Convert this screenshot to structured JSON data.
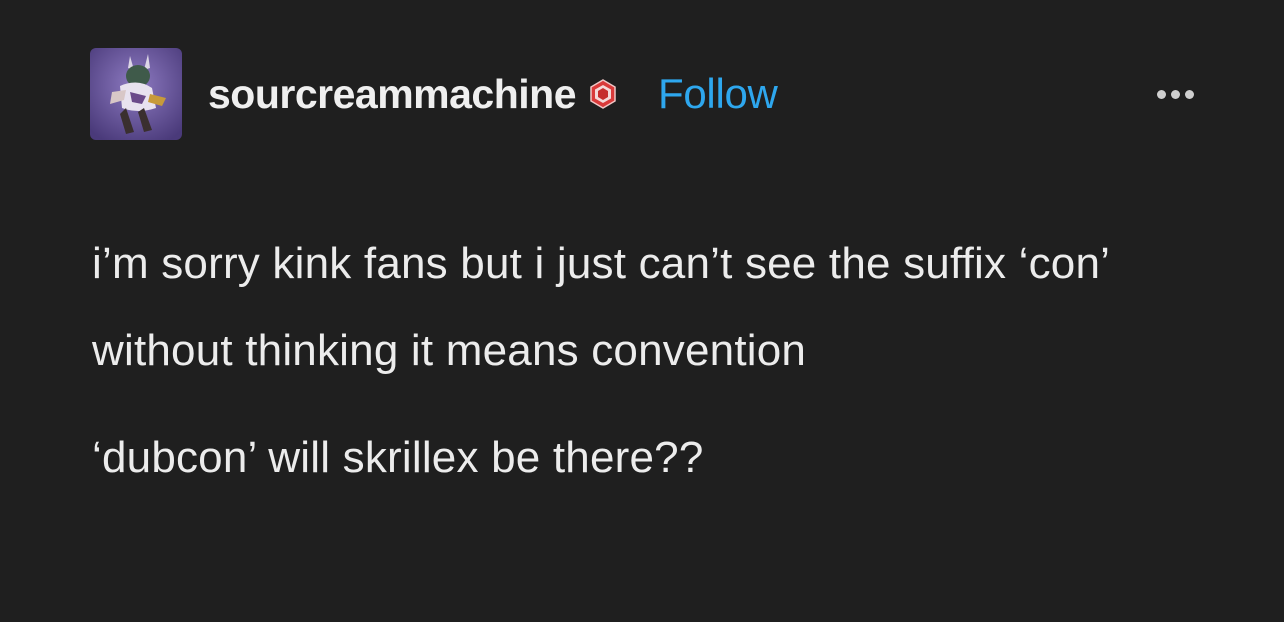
{
  "post": {
    "author": {
      "username": "sourcreammachine",
      "follow_label": "Follow",
      "badge_icon": "hexagon-badge-icon",
      "avatar_icon": "character-avatar"
    },
    "menu_icon": "more-options-icon",
    "paragraphs": [
      "i’m sorry kink fans but i just can’t see the suffix ‘con’ without thinking it means convention",
      "‘dubcon’ will skrillex be there??"
    ]
  },
  "colors": {
    "background": "#1f1f1f",
    "text": "#ececec",
    "follow": "#2ea7ee",
    "badge": "#d93a3a"
  }
}
